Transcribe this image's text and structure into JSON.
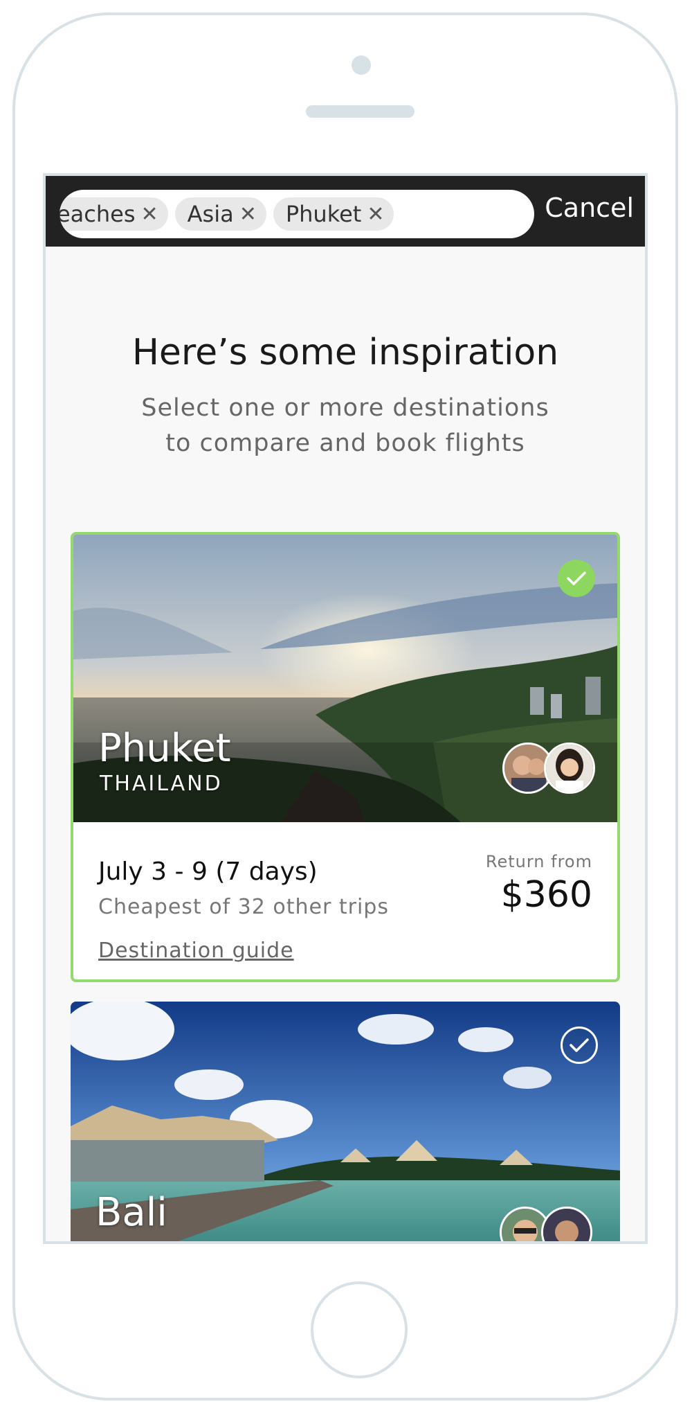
{
  "search": {
    "chips": [
      {
        "label": "Beaches"
      },
      {
        "label": "Asia"
      },
      {
        "label": "Phuket"
      }
    ],
    "cancel_label": "Cancel"
  },
  "intro": {
    "title": "Here’s some inspiration",
    "subtitle_line1": "Select one or more destinations",
    "subtitle_line2": "to compare and book flights"
  },
  "destinations": [
    {
      "name": "Phuket",
      "country": "THAILAND",
      "selected": true,
      "dates": "July 3 - 9 (7 days)",
      "cheapest": "Cheapest of 32 other trips",
      "guide_label": "Destination guide",
      "return_label": "Return from",
      "price": "$360"
    },
    {
      "name": "Bali",
      "selected": false
    }
  ],
  "colors": {
    "topbar": "#222222",
    "selected_border": "#94d96e",
    "check_green": "#8dd65f",
    "screen_bg": "#f8f8f8"
  },
  "icons": [
    "close-icon",
    "check-icon"
  ]
}
